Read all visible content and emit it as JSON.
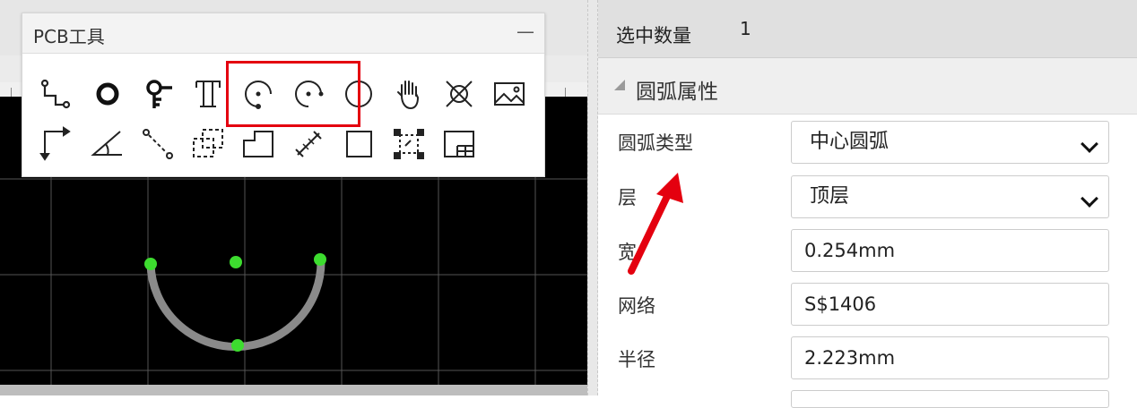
{
  "tool_panel": {
    "title": "PCB工具",
    "minimize": "—",
    "tools_row1": [
      "track-icon",
      "pad-icon",
      "via-icon",
      "text-icon",
      "arc-start-icon",
      "arc-center-icon",
      "circle-icon",
      "hand-icon",
      "no-connect-icon",
      "image-icon"
    ],
    "tools_row2": [
      "dimension-icon",
      "angle-icon",
      "connect-pad-icon",
      "copper-area-icon",
      "solid-region-icon",
      "measure-icon",
      "rectangle-icon",
      "snap-icon",
      "board-outline-icon"
    ],
    "highlight_color": "#e4000f"
  },
  "canvas": {
    "background": "#000000",
    "grid_color": "#555555",
    "arc_color": "#8a8a8a",
    "handle_color": "#3ddc2f"
  },
  "properties": {
    "selection": {
      "label": "选中数量",
      "count": "1"
    },
    "section_title": "圆弧属性",
    "fields": {
      "arc_type": {
        "label": "圆弧类型",
        "value": "中心圆弧"
      },
      "layer": {
        "label": "层",
        "value": "顶层"
      },
      "width": {
        "label": "宽",
        "value": "0.254mm"
      },
      "net": {
        "label": "网络",
        "value": "S$1406"
      },
      "radius": {
        "label": "半径",
        "value": "2.223mm"
      }
    }
  },
  "annotation": {
    "arrow_color": "#e4000f"
  }
}
